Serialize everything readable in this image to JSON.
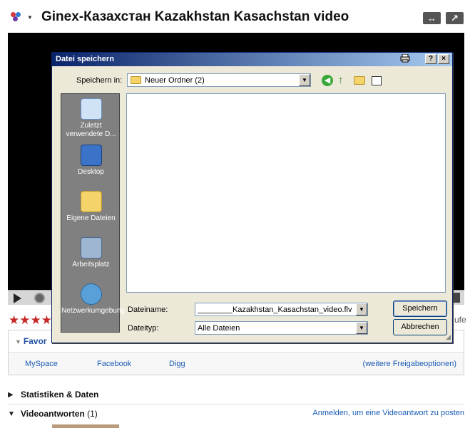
{
  "page": {
    "title": "Ginex-Казахстан Kazakhstan Kasachstan video",
    "header_icons": [
      "color-dots-icon",
      "chevron-down-icon",
      "expand-arrows-icon",
      "popout-arrow-icon"
    ],
    "expand_glyph": "↔",
    "popout_glyph": "↗"
  },
  "player": {
    "rating_stars": "★★★★",
    "views_tail": "ufe"
  },
  "share": {
    "tab_label": "Favor",
    "links": [
      "MySpace",
      "Facebook",
      "Digg"
    ],
    "more_link": "(weitere Freigabeoptionen)"
  },
  "sections": {
    "stats_label": "Statistiken & Daten",
    "responses_label": "Videoantworten",
    "responses_count": "(1)",
    "post_link": "Anmelden, um eine Videoantwort zu posten"
  },
  "dialog": {
    "title": "Datei speichern",
    "help_label": "?",
    "close_label": "×",
    "lookin_label": "Speichern in:",
    "lookin_value": "Neuer Ordner (2)",
    "places": [
      {
        "label": "Zuletzt verwendete D...",
        "icon": "recent-docs-icon"
      },
      {
        "label": "Desktop",
        "icon": "desktop-icon"
      },
      {
        "label": "Eigene Dateien",
        "icon": "my-documents-icon"
      },
      {
        "label": "Arbeitsplatz",
        "icon": "my-computer-icon"
      },
      {
        "label": "Netzwerkumgebung",
        "icon": "network-icon"
      }
    ],
    "filename_label": "Dateiname:",
    "filename_value": "________Kazakhstan_Kasachstan_video.flv",
    "filetype_label": "Dateityp:",
    "filetype_value": "Alle Dateien",
    "save_button": "Speichern",
    "cancel_button": "Abbrechen"
  },
  "colors": {
    "titlebar_start": "#0a246a",
    "titlebar_end": "#a6caf0",
    "dialog_bg": "#ece9d8",
    "link": "#1a5bb5",
    "stars": "#c62828"
  }
}
